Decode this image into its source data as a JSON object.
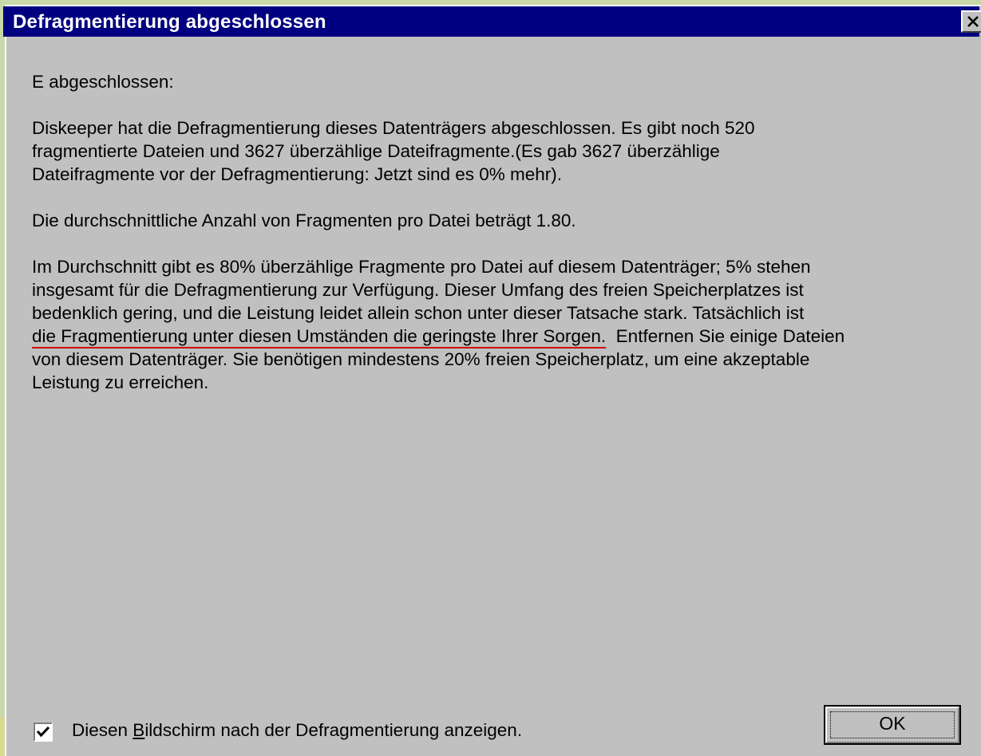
{
  "window": {
    "title": "Defragmentierung abgeschlossen",
    "close_symbol": "×"
  },
  "body": {
    "drive_line": "E abgeschlossen:",
    "p1": [
      "Diskeeper hat die Defragmentierung dieses Datenträgers abgeschlossen. Es gibt noch 520",
      "fragmentierte Dateien und 3627 überzählige Dateifragmente.(Es gab 3627 überzählige",
      "Dateifragmente vor der Defragmentierung: Jetzt sind es 0% mehr)."
    ],
    "p2": "Die durchschnittliche Anzahl von Fragmenten pro Datei beträgt 1.80.",
    "p3": {
      "line1": "Im Durchschnitt gibt es 80% überzählige Fragmente pro Datei auf diesem Datenträger; 5% stehen",
      "line2": "insgesamt für die Defragmentierung zur Verfügung.  Dieser Umfang des freien Speicherplatzes ist",
      "line3": "bedenklich gering, und die Leistung leidet allein schon unter dieser Tatsache stark.  Tatsächlich ist",
      "line4_underlined": "die Fragmentierung unter diesen Umständen die geringste Ihrer Sorgen.",
      "line4_rest": "  Entfernen Sie einige Dateien",
      "line5": "von diesem Datenträger. Sie benötigen mindestens 20% freien Speicherplatz, um eine akzeptable",
      "line6": "Leistung zu erreichen."
    }
  },
  "footer": {
    "checkbox_checked": true,
    "checkbox_label_before": "Diesen ",
    "checkbox_label_mnemonic": "B",
    "checkbox_label_after": "ildschirm nach der Defragmentierung anzeigen.",
    "ok_label": "OK"
  },
  "colors": {
    "titlebar": "#000080",
    "dialog_face": "#c0c0c0",
    "underline_accent": "#d00000"
  }
}
